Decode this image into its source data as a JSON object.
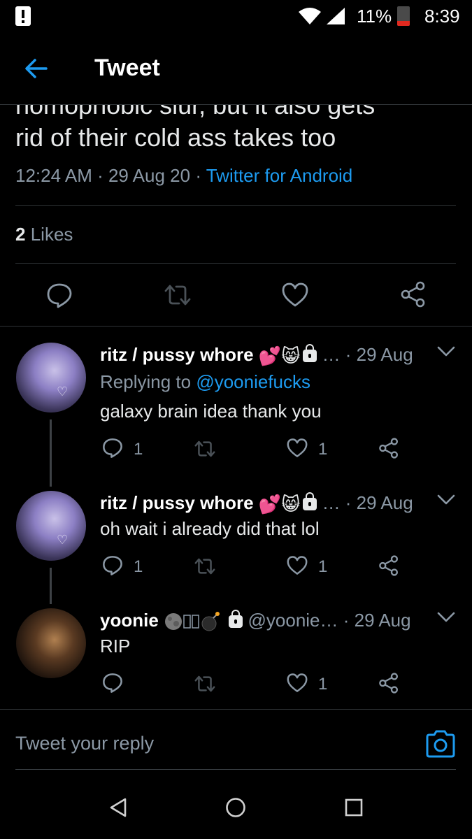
{
  "status_bar": {
    "battery": "11%",
    "time": "8:39"
  },
  "header": {
    "title": "Tweet"
  },
  "tweet": {
    "text_cut": "homophobic slur, but it also gets",
    "text": "rid of their cold ass takes too",
    "time": "12:24 AM",
    "sep1": " · ",
    "date": "29 Aug 20",
    "sep2": " · ",
    "source": "Twitter for Android",
    "likes_count": "2",
    "likes_label": "Likes"
  },
  "replies": [
    {
      "name": "ritz / pussy whore",
      "handle": "…",
      "date": "· 29 Aug",
      "replying_prefix": "Replying to ",
      "replying_handle": "@yooniefucks",
      "text": "galaxy brain idea thank you",
      "reply_count": "1",
      "like_count": "1"
    },
    {
      "name": "ritz / pussy whore",
      "handle": "…",
      "date": "· 29 Aug",
      "text": "oh wait i already did that lol",
      "reply_count": "1",
      "like_count": "1"
    },
    {
      "name": "yoonie",
      "handle": "@yoonie…",
      "date": "· 29 Aug",
      "text": "RIP",
      "like_count": "1"
    }
  ],
  "composer": {
    "placeholder": "Tweet your reply"
  },
  "colors": {
    "background": "#000000",
    "accent": "#1d9bf0",
    "secondary_text": "#8b98a5",
    "divider": "#2f3336"
  },
  "icons": [
    "alert-icon",
    "wifi-icon",
    "signal-icon",
    "battery-icon",
    "back-arrow-icon",
    "reply-icon",
    "retweet-icon",
    "like-icon",
    "share-icon",
    "chevron-down-icon",
    "camera-icon",
    "nav-back-icon",
    "nav-home-icon",
    "nav-recents-icon"
  ]
}
